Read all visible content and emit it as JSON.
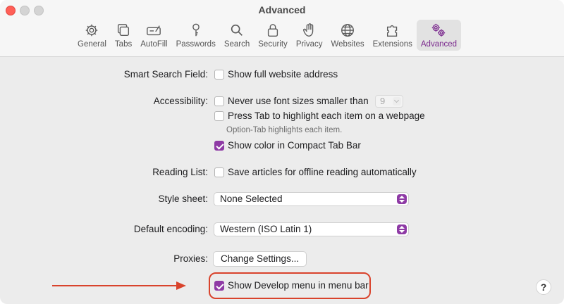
{
  "window": {
    "title": "Advanced"
  },
  "toolbar": {
    "tabs": [
      {
        "label": "General",
        "icon": "gear-icon"
      },
      {
        "label": "Tabs",
        "icon": "tabs-icon"
      },
      {
        "label": "AutoFill",
        "icon": "autofill-icon"
      },
      {
        "label": "Passwords",
        "icon": "key-icon"
      },
      {
        "label": "Search",
        "icon": "search-icon"
      },
      {
        "label": "Security",
        "icon": "lock-icon"
      },
      {
        "label": "Privacy",
        "icon": "hand-icon"
      },
      {
        "label": "Websites",
        "icon": "globe-icon"
      },
      {
        "label": "Extensions",
        "icon": "puzzle-icon"
      },
      {
        "label": "Advanced",
        "icon": "advanced-gears-icon",
        "active": true
      }
    ]
  },
  "settings": {
    "smart_search": {
      "label": "Smart Search Field:",
      "option": "Show full website address",
      "checked": false
    },
    "accessibility": {
      "label": "Accessibility:",
      "font_option": "Never use font sizes smaller than",
      "font_size": "9",
      "tab_option": "Press Tab to highlight each item on a webpage",
      "tab_hint": "Option-Tab highlights each item.",
      "color_option": "Show color in Compact Tab Bar",
      "color_checked": true
    },
    "reading_list": {
      "label": "Reading List:",
      "option": "Save articles for offline reading automatically",
      "checked": false
    },
    "style_sheet": {
      "label": "Style sheet:",
      "value": "None Selected"
    },
    "encoding": {
      "label": "Default encoding:",
      "value": "Western (ISO Latin 1)"
    },
    "proxies": {
      "label": "Proxies:",
      "button": "Change Settings..."
    },
    "develop": {
      "option": "Show Develop menu in menu bar",
      "checked": true
    }
  },
  "help": {
    "label": "?"
  },
  "colors": {
    "accent": "#8e3aa5",
    "highlight": "#d9432c"
  }
}
